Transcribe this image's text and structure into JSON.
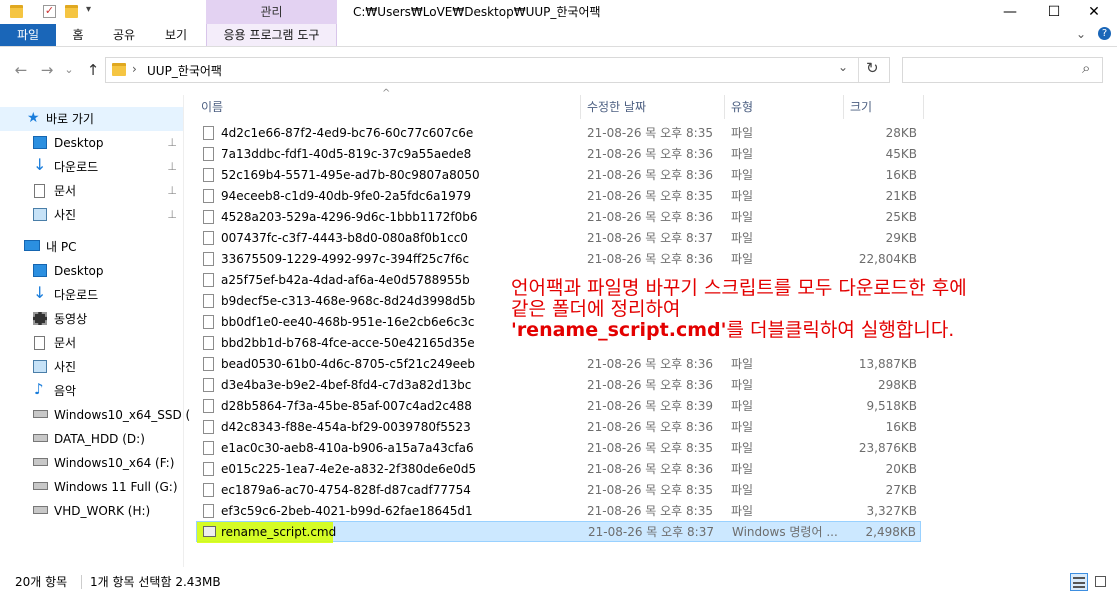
{
  "title_bar": {
    "manage_tab": "관리",
    "path": "C:₩Users₩LoVE₩Desktop₩UUP_한국어팩",
    "minimize": "—",
    "maximize": "☐",
    "close": "✕"
  },
  "ribbon": {
    "tabs": [
      "파일",
      "홈",
      "공유",
      "보기",
      "응용 프로그램 도구"
    ],
    "collapse": "⌄",
    "help": "?"
  },
  "nav": {
    "back": "←",
    "forward": "→",
    "dropdown": "⌄",
    "up": "↑",
    "breadcrumb_sep": "›",
    "breadcrumb": "UUP_한국어팩",
    "addr_dropdown": "⌄",
    "refresh": "↻",
    "search_placeholder": "",
    "search_icon": "⌕"
  },
  "sidebar": {
    "quick_access": "바로 가기",
    "quick_items": [
      "Desktop",
      "다운로드",
      "문서",
      "사진"
    ],
    "pin": "📌",
    "this_pc": "내 PC",
    "pc_items": [
      "Desktop",
      "다운로드",
      "동영상",
      "문서",
      "사진",
      "음악",
      "Windows10_x64_SSD (",
      "DATA_HDD (D:)",
      "Windows10_x64 (F:)",
      "Windows 11 Full (G:)",
      "VHD_WORK (H:)"
    ]
  },
  "columns": {
    "name": "이름",
    "date": "수정한 날짜",
    "type": "유형",
    "size": "크기",
    "sort_indicator": "^"
  },
  "files": [
    {
      "name": "4d2c1e66-87f2-4ed9-bc76-60c77c607c6e",
      "date": "21-08-26 목 오후 8:35",
      "type": "파일",
      "size": "28KB"
    },
    {
      "name": "7a13ddbc-fdf1-40d5-819c-37c9a55aede8",
      "date": "21-08-26 목 오후 8:36",
      "type": "파일",
      "size": "45KB"
    },
    {
      "name": "52c169b4-5571-495e-ad7b-80c9807a8050",
      "date": "21-08-26 목 오후 8:36",
      "type": "파일",
      "size": "16KB"
    },
    {
      "name": "94eceeb8-c1d9-40db-9fe0-2a5fdc6a1979",
      "date": "21-08-26 목 오후 8:35",
      "type": "파일",
      "size": "21KB"
    },
    {
      "name": "4528a203-529a-4296-9d6c-1bbb1172f0b6",
      "date": "21-08-26 목 오후 8:36",
      "type": "파일",
      "size": "25KB"
    },
    {
      "name": "007437fc-c3f7-4443-b8d0-080a8f0b1cc0",
      "date": "21-08-26 목 오후 8:37",
      "type": "파일",
      "size": "29KB"
    },
    {
      "name": "33675509-1229-4992-997c-394ff25c7f6c",
      "date": "21-08-26 목 오후 8:36",
      "type": "파일",
      "size": "22,804KB"
    },
    {
      "name": "a25f75ef-b42a-4dad-af6a-4e0d5788955b",
      "date": "",
      "type": "",
      "size": ""
    },
    {
      "name": "b9decf5e-c313-468e-968c-8d24d3998d5b",
      "date": "",
      "type": "",
      "size": ""
    },
    {
      "name": "bb0df1e0-ee40-468b-951e-16e2cb6e6c3c",
      "date": "",
      "type": "",
      "size": ""
    },
    {
      "name": "bbd2bb1d-b768-4fce-acce-50e42165d35e",
      "date": "",
      "type": "",
      "size": ""
    },
    {
      "name": "bead0530-61b0-4d6c-8705-c5f21c249eeb",
      "date": "21-08-26 목 오후 8:36",
      "type": "파일",
      "size": "13,887KB"
    },
    {
      "name": "d3e4ba3e-b9e2-4bef-8fd4-c7d3a82d13bc",
      "date": "21-08-26 목 오후 8:36",
      "type": "파일",
      "size": "298KB"
    },
    {
      "name": "d28b5864-7f3a-45be-85af-007c4ad2c488",
      "date": "21-08-26 목 오후 8:39",
      "type": "파일",
      "size": "9,518KB"
    },
    {
      "name": "d42c8343-f88e-454a-bf29-0039780f5523",
      "date": "21-08-26 목 오후 8:36",
      "type": "파일",
      "size": "16KB"
    },
    {
      "name": "e1ac0c30-aeb8-410a-b906-a15a7a43cfa6",
      "date": "21-08-26 목 오후 8:35",
      "type": "파일",
      "size": "23,876KB"
    },
    {
      "name": "e015c225-1ea7-4e2e-a832-2f380de6e0d5",
      "date": "21-08-26 목 오후 8:36",
      "type": "파일",
      "size": "20KB"
    },
    {
      "name": "ec1879a6-ac70-4754-828f-d87cadf77754",
      "date": "21-08-26 목 오후 8:35",
      "type": "파일",
      "size": "27KB"
    },
    {
      "name": "ef3c59c6-2beb-4021-b99d-62fae18645d1",
      "date": "21-08-26 목 오후 8:35",
      "type": "파일",
      "size": "3,327KB"
    },
    {
      "name": "rename_script.cmd",
      "date": "21-08-26 목 오후 8:37",
      "type": "Windows 명령어 ...",
      "size": "2,498KB",
      "selected": true
    }
  ],
  "annotation": {
    "line1": "언어팩과 파일명 바꾸기 스크립트를 모두 다운로드한 후에",
    "line2": "같은 폴더에 정리하여",
    "line3_bold": "'rename_script.cmd'",
    "line3_rest": "를 더블클릭하여 실행합니다."
  },
  "status": {
    "count": "20개 항목",
    "selection": "1개 항목 선택함 2.43MB"
  },
  "colors": {
    "file_tab": "#1a66b8",
    "manage_tab": "#e3d2f2",
    "selected_row": "#cce8ff",
    "highlight": "#d6ff00",
    "annotation": "#e30000"
  }
}
